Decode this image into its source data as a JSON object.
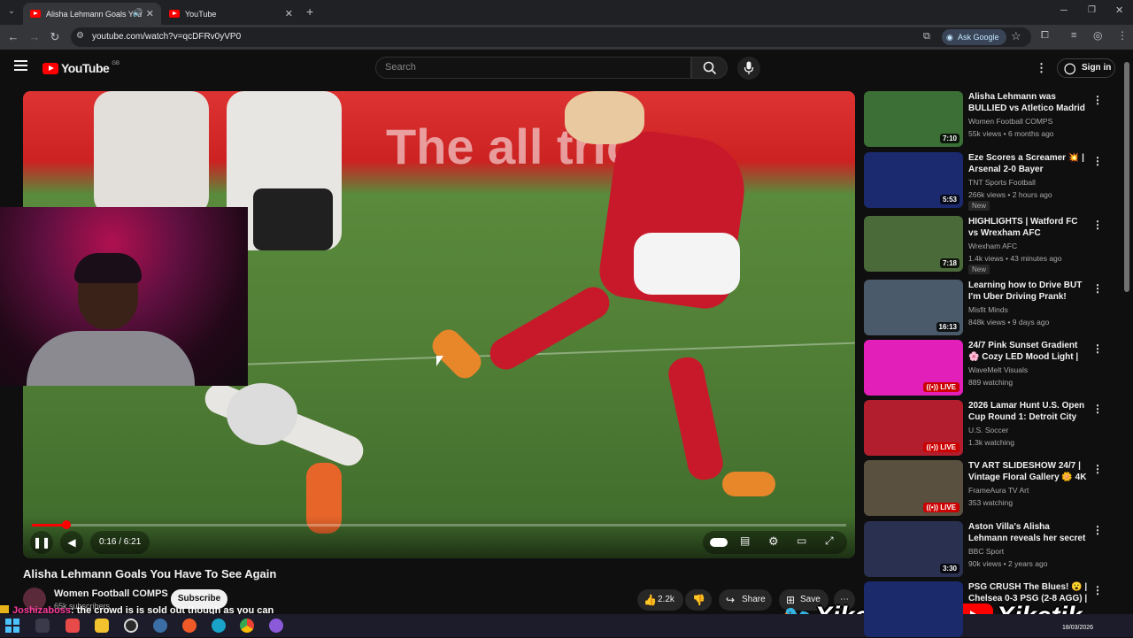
{
  "browser": {
    "tabs": [
      {
        "label": "Alisha Lehmann Goals You"
      },
      {
        "label": "YouTube"
      }
    ],
    "url": "youtube.com/watch?v=qcDFRv0yVP0",
    "ask_google": "Ask Google",
    "new_tab": "+"
  },
  "header": {
    "logo": "YouTube",
    "region": "GB",
    "search_placeholder": "Search",
    "sign_in": "Sign in"
  },
  "video": {
    "banner_text": "The all    tric",
    "current_time": "0:16 / 6:21",
    "progress": 0.042
  },
  "title": "Alisha Lehmann Goals You Have To See Again",
  "channel": {
    "name": "Women Football COMPS",
    "subscribers": "65k subscribers",
    "subscribe": "Subscribe"
  },
  "actions": {
    "likes": "2.2k",
    "share": "Share",
    "save": "Save"
  },
  "recommendations": [
    {
      "title": "Alisha Lehmann was BULLIED vs Atletico Madrid 2025 HD",
      "channel": "Women Football COMPS",
      "meta": "55k views • 6 months ago",
      "duration": "7:10",
      "live": false,
      "new": false,
      "color": "#3b6f35"
    },
    {
      "title": "Eze Scores a Screamer 💥 | Arsenal 2-0 Bayer Leverkusen ...",
      "channel": "TNT Sports Football",
      "meta": "266k views • 2 hours ago",
      "duration": "5:53",
      "live": false,
      "new": true,
      "color": "#1b2a6e"
    },
    {
      "title": "HIGHLIGHTS | Watford FC vs Wrexham AFC",
      "channel": "Wrexham AFC",
      "meta": "1.4k views • 43 minutes ago",
      "duration": "7:18",
      "live": false,
      "new": true,
      "color": "#4a6a3a"
    },
    {
      "title": "Learning how to Drive BUT I'm Uber Driving Prank!",
      "channel": "Misfit Minds",
      "meta": "848k views • 9 days ago",
      "duration": "16:13",
      "live": false,
      "new": false,
      "color": "#4a5a6a"
    },
    {
      "title": "24/7 Pink Sunset Gradient 🌸 Cozy LED Mood Light | 4K ...",
      "channel": "WaveMelt Visuals",
      "meta": "889 watching",
      "duration": "LIVE",
      "live": true,
      "new": false,
      "color": "#e21fb8"
    },
    {
      "title": "2026 Lamar Hunt U.S. Open Cup Round 1: Detroit City FC v...",
      "channel": "U.S. Soccer",
      "meta": "1.3k watching",
      "duration": "LIVE",
      "live": true,
      "new": false,
      "color": "#b21e2e"
    },
    {
      "title": "TV ART SLIDESHOW 24/7 | Vintage Floral Gallery 🌼 4K ...",
      "channel": "FrameAura TV Art",
      "meta": "353 watching",
      "duration": "LIVE",
      "live": true,
      "new": false,
      "color": "#5a5040"
    },
    {
      "title": "Aston Villa's Alisha Lehmann reveals her secret talent | ...",
      "channel": "BBC Sport",
      "meta": "90k views • 2 years ago",
      "duration": "3:30",
      "live": false,
      "new": false,
      "color": "#2a3050"
    },
    {
      "title": "PSG CRUSH The Blues! 😮 | Chelsea 0-3 PSG (2-8 AGG) | ...",
      "channel": "",
      "meta": "",
      "duration": "",
      "live": false,
      "new": false,
      "color": "#1a2a6a"
    }
  ],
  "chat": {
    "user": "Joshizaboss",
    "message": ": the crowd is is sold out though as you can"
  },
  "brand": {
    "left": "Xiketikk",
    "right": "Xiketik"
  },
  "taskbar": {
    "date": "18/03/2026"
  },
  "colors": {
    "youtube_red": "#ff0000",
    "background": "#0f0f0f",
    "live_red": "#cc0000"
  }
}
